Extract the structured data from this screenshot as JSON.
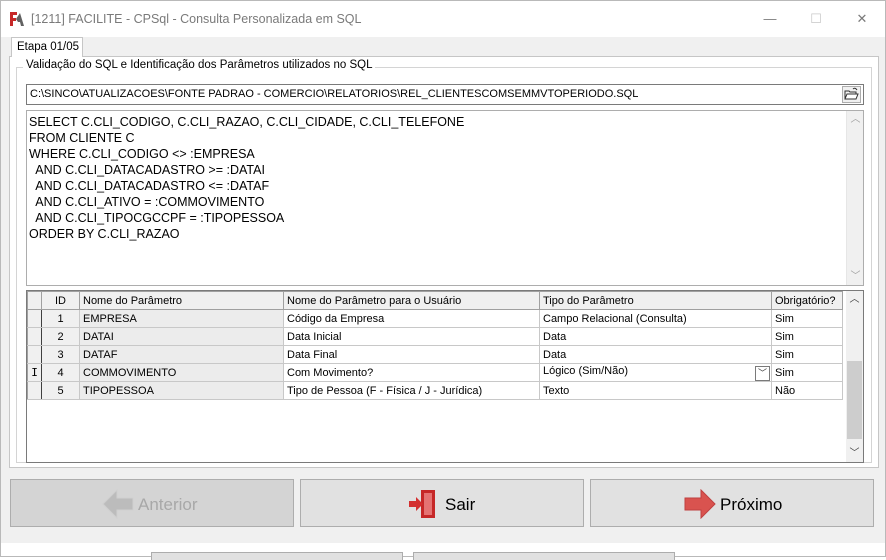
{
  "window": {
    "title": "[1211] FACILITE - CPSql - Consulta Personalizada em SQL",
    "minimize_glyph": "—",
    "maximize_glyph": "☐",
    "close_glyph": "✕"
  },
  "tab": {
    "label": "Etapa 01/05"
  },
  "group": {
    "legend": "Validação do SQL e Identificação dos Parâmetros utilizados no SQL"
  },
  "path": {
    "value": "C:\\SINCO\\ATUALIZACOES\\FONTE PADRAO - COMERCIO\\RELATORIOS\\REL_CLIENTESCOMSEMMVTOPERIODO.SQL",
    "button_icon": "open-folder-icon"
  },
  "sql": {
    "text": "SELECT C.CLI_CODIGO, C.CLI_RAZAO, C.CLI_CIDADE, C.CLI_TELEFONE\nFROM CLIENTE C\nWHERE C.CLI_CODIGO <> :EMPRESA\n  AND C.CLI_DATACADASTRO >= :DATAI\n  AND C.CLI_DATACADASTRO <= :DATAF\n  AND C.CLI_ATIVO = :COMMOVIMENTO\n  AND C.CLI_TIPOCGCCPF = :TIPOPESSOA\nORDER BY C.CLI_RAZAO"
  },
  "grid": {
    "headers": {
      "id": "ID",
      "name": "Nome do Parâmetro",
      "user_name": "Nome do Parâmetro para o Usuário",
      "type": "Tipo do Parâmetro",
      "required": "Obrigatório?"
    },
    "rows": [
      {
        "indicator": "",
        "id": "1",
        "name": "EMPRESA",
        "user_name": "Código da Empresa",
        "type": "Campo Relacional (Consulta)",
        "required": "Sim"
      },
      {
        "indicator": "",
        "id": "2",
        "name": "DATAI",
        "user_name": "Data Inicial",
        "type": "Data",
        "required": "Sim"
      },
      {
        "indicator": "",
        "id": "3",
        "name": "DATAF",
        "user_name": "Data Final",
        "type": "Data",
        "required": "Sim"
      },
      {
        "indicator": "I",
        "id": "4",
        "name": "COMMOVIMENTO",
        "user_name": "Com Movimento?",
        "type": "Lógico (Sim/Não)",
        "required": "Sim"
      },
      {
        "indicator": "",
        "id": "5",
        "name": "TIPOPESSOA",
        "user_name": "Tipo de Pessoa (F - Física / J - Jurídica)",
        "type": "Texto",
        "required": "Não"
      }
    ]
  },
  "buttons": {
    "previous": "Anterior",
    "exit": "Sair",
    "next": "Próximo"
  },
  "colors": {
    "accent_red": "#d9534f",
    "disabled_text": "#a8a8a8"
  }
}
